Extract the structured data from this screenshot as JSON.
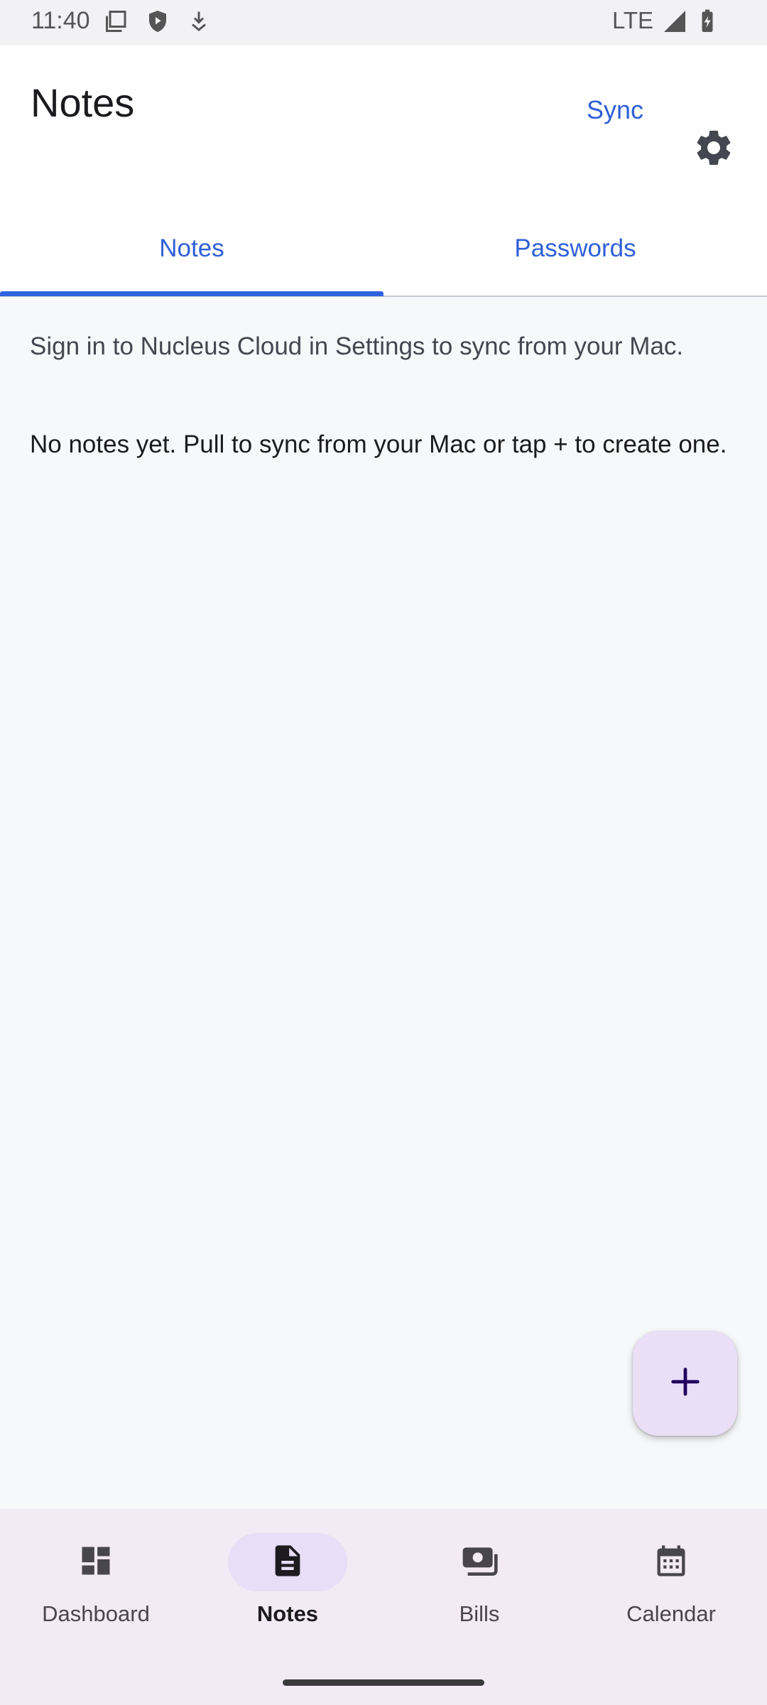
{
  "status_bar": {
    "time": "11:40",
    "network": "LTE",
    "icons": [
      "screenshot-icon",
      "shield-icon",
      "download-icon",
      "signal-icon",
      "battery-charging-icon"
    ]
  },
  "header": {
    "title": "Notes",
    "sync_label": "Sync",
    "settings_icon": "gear-icon"
  },
  "tabs": [
    {
      "label": "Notes",
      "selected": true
    },
    {
      "label": "Passwords",
      "selected": false
    }
  ],
  "content": {
    "signin_message": "Sign in to Nucleus Cloud in Settings to sync from your Mac.",
    "empty_message": "No notes yet. Pull to sync from your Mac or tap + to create one."
  },
  "fab": {
    "icon": "plus-icon"
  },
  "bottom_nav": {
    "items": [
      {
        "label": "Dashboard",
        "icon": "dashboard-icon",
        "selected": false
      },
      {
        "label": "Notes",
        "icon": "note-icon",
        "selected": true
      },
      {
        "label": "Bills",
        "icon": "bills-icon",
        "selected": false
      },
      {
        "label": "Calendar",
        "icon": "calendar-icon",
        "selected": false
      }
    ]
  },
  "colors": {
    "accent": "#2f5fd8",
    "fab_bg": "#eadff7",
    "nav_bg": "#f2ebf5",
    "nav_active_pill": "#e8def8"
  }
}
